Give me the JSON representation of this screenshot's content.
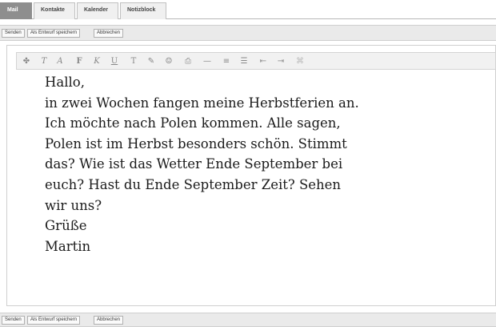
{
  "tabs": [
    {
      "label": "Mail",
      "active": true
    },
    {
      "label": "Kontakte",
      "active": false
    },
    {
      "label": "Kalender",
      "active": false
    },
    {
      "label": "Notizblock",
      "active": false
    }
  ],
  "actions": {
    "send": "Senden",
    "save_draft": "Als Entwurf speichern",
    "cancel": "Abbrechen"
  },
  "toolbar": {
    "icons": [
      "spellcheck-icon",
      "font-size-icon",
      "font-color-icon",
      "bold-icon",
      "italic-icon",
      "underline-icon",
      "clear-format-icon",
      "draw-icon",
      "emoji-icon",
      "print-icon",
      "horizontal-rule-icon",
      "align-icon",
      "list-icon",
      "outdent-icon",
      "indent-icon",
      "link-icon"
    ]
  },
  "message": {
    "lines": [
      "Hallo,",
      "in zwei Wochen fangen meine Herbstferien an.",
      "Ich möchte nach Polen kommen. Alle sagen,",
      "Polen ist im Herbst besonders schön. Stimmt",
      "das? Wie ist das Wetter Ende September bei",
      "euch? Hast du Ende September Zeit? Sehen",
      "wir uns?",
      "Grüße",
      "Martin"
    ]
  },
  "colors": {
    "active_tab": "#8e8e8e",
    "bar": "#eaeaea"
  }
}
